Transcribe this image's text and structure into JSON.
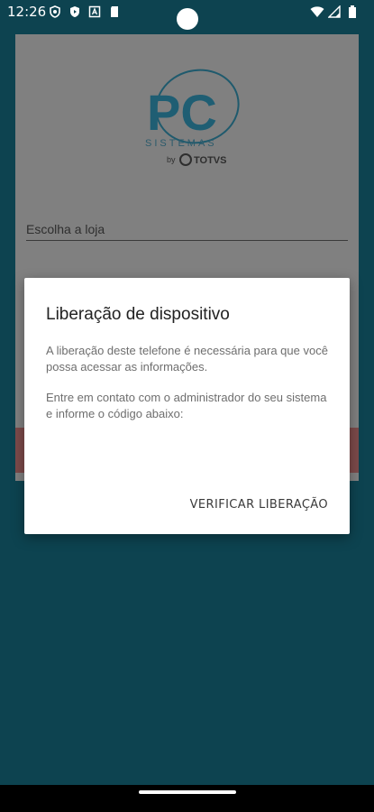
{
  "status_bar": {
    "time": "12:26",
    "icons_left": [
      "shield-icon",
      "play-shield-icon",
      "a-box-icon",
      "sd-card-icon"
    ],
    "icons_right": [
      "wifi-icon",
      "signal-icon",
      "battery-icon"
    ]
  },
  "app": {
    "logo_text": "PC",
    "logo_subtitle": "SISTEMAS",
    "logo_by": "by",
    "logo_brand": "TOTVS",
    "store_label": "Escolha a loja"
  },
  "dialog": {
    "title": "Liberação de dispositivo",
    "message1": "A liberação deste telefone é necessária para que você possa acessar as informações.",
    "message2": "Entre em contato com o administrador do seu sistema e informe o código abaixo:",
    "verify_button": "VERIFICAR LIBERAÇÃO"
  },
  "colors": {
    "background": "#0d4350",
    "scrim": "#808080",
    "logo_blue": "#1f6a86",
    "logo_gold": "#c88a1a"
  }
}
